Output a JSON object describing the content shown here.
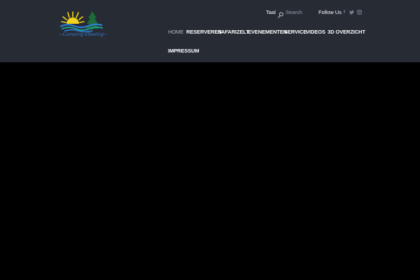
{
  "brand": {
    "name": "~Camping Elbeling~"
  },
  "topbar": {
    "language_label": "Taal",
    "search_placeholder": "Search",
    "follow_label": "Follow Us",
    "social": [
      {
        "icon": "facebook-icon",
        "glyph": "f"
      },
      {
        "icon": "twitter-icon",
        "glyph": "t"
      },
      {
        "icon": "instagram-icon",
        "glyph": "◘"
      }
    ]
  },
  "nav": {
    "items": [
      {
        "label": "HOME",
        "active": true
      },
      {
        "label": "RESERVEREN"
      },
      {
        "label": "SAFARIZELT"
      },
      {
        "label": "EVENEMENTEN"
      },
      {
        "label": "SERVICE"
      },
      {
        "label": "VIDEOS"
      },
      {
        "label": "3D OVERZICHT"
      },
      {
        "label": "IMPRESSUM"
      }
    ]
  },
  "colors": {
    "header_bg": "#262b34",
    "page_bg": "#000000",
    "nav_text": "#ffffff",
    "nav_active": "#b3b9c2",
    "logo_blue": "#3b7fd0",
    "logo_sun": "#f3d21b",
    "logo_tree": "#1e6b3a"
  }
}
